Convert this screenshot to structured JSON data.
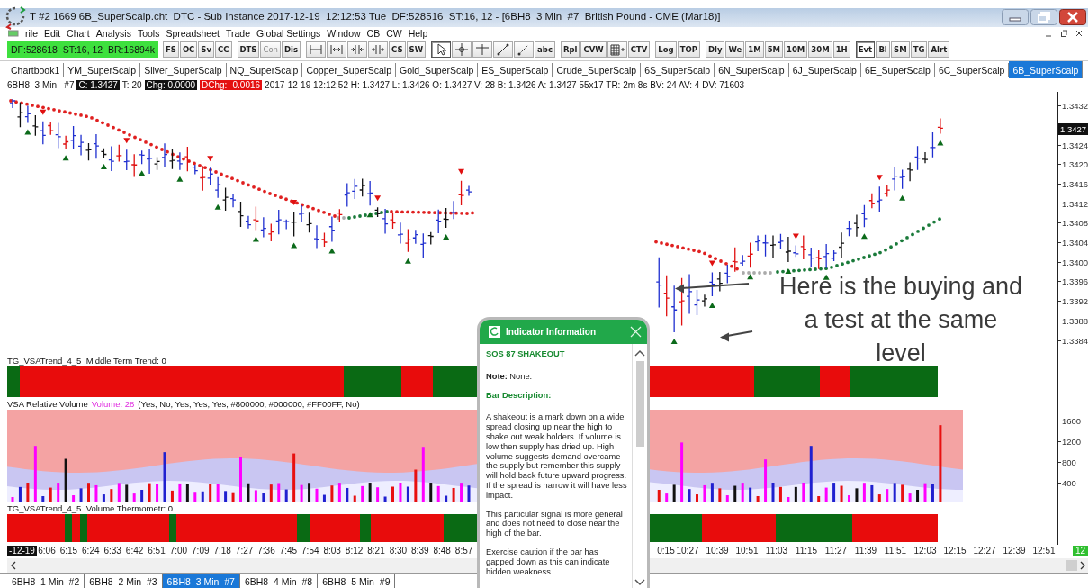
{
  "window": {
    "title": "T #2 1669 6B_SuperScalp.cht  DTC - Sub Instance 2017-12-19  12:12:53 Tue  DF:528516  ST:16, 12 - [6BH8  3 Min  #7  British Pound - CME (Mar18)]"
  },
  "menu": [
    "rile",
    "Edit",
    "Chart",
    "Analysis",
    "Tools",
    "Spreadsheet",
    "Trade",
    "Global Settings",
    "Window",
    "CB",
    "CW",
    "Help"
  ],
  "status_box": "DF:528618  ST:16, 12  BR:16894k",
  "toolbar": [
    {
      "kind": "text",
      "label": "FS",
      "disabled": false,
      "on": false
    },
    {
      "kind": "text",
      "label": "OC",
      "disabled": false,
      "on": false
    },
    {
      "kind": "text",
      "label": "Sv",
      "disabled": false,
      "on": false
    },
    {
      "kind": "text",
      "label": "CC",
      "disabled": false,
      "on": false
    },
    {
      "kind": "separator"
    },
    {
      "kind": "text",
      "label": "DTS",
      "disabled": false,
      "on": false
    },
    {
      "kind": "text",
      "label": "Con",
      "disabled": true,
      "on": false
    },
    {
      "kind": "text",
      "label": "Dis",
      "disabled": false,
      "on": false
    },
    {
      "kind": "separator"
    },
    {
      "kind": "icon",
      "disabled": false,
      "on": false
    },
    {
      "kind": "icon",
      "disabled": false,
      "on": false
    },
    {
      "kind": "icon",
      "disabled": false,
      "on": false
    },
    {
      "kind": "icon",
      "disabled": false,
      "on": false
    },
    {
      "kind": "text",
      "label": "CS",
      "disabled": false,
      "on": false
    },
    {
      "kind": "text",
      "label": "SW",
      "disabled": false,
      "on": false
    },
    {
      "kind": "separator"
    },
    {
      "kind": "icon",
      "disabled": false,
      "on": true
    },
    {
      "kind": "icon",
      "disabled": false,
      "on": false
    },
    {
      "kind": "icon",
      "disabled": false,
      "on": false
    },
    {
      "kind": "icon",
      "disabled": false,
      "on": false
    },
    {
      "kind": "icon",
      "disabled": false,
      "on": false
    },
    {
      "kind": "text",
      "label": "abc",
      "disabled": false,
      "on": false
    },
    {
      "kind": "separator"
    },
    {
      "kind": "text",
      "label": "Rpl",
      "disabled": false,
      "on": false
    },
    {
      "kind": "text",
      "label": "CVW",
      "disabled": false,
      "on": false
    },
    {
      "kind": "icon",
      "disabled": false,
      "on": false
    },
    {
      "kind": "text",
      "label": "CTV",
      "disabled": false,
      "on": false
    },
    {
      "kind": "separator"
    },
    {
      "kind": "text",
      "label": "Log",
      "disabled": false,
      "on": false
    },
    {
      "kind": "text",
      "label": "TOP",
      "disabled": false,
      "on": false
    },
    {
      "kind": "separator"
    },
    {
      "kind": "text",
      "label": "Dly",
      "disabled": false,
      "on": false
    },
    {
      "kind": "text",
      "label": "We",
      "disabled": false,
      "on": false
    },
    {
      "kind": "text",
      "label": "1M",
      "disabled": false,
      "on": false
    },
    {
      "kind": "text",
      "label": "5M",
      "disabled": false,
      "on": false
    },
    {
      "kind": "text",
      "label": "10M",
      "disabled": false,
      "on": false
    },
    {
      "kind": "text",
      "label": "30M",
      "disabled": false,
      "on": false
    },
    {
      "kind": "text",
      "label": "1H",
      "disabled": false,
      "on": false
    },
    {
      "kind": "separator"
    },
    {
      "kind": "text",
      "label": "Evt",
      "disabled": false,
      "on": true
    },
    {
      "kind": "text",
      "label": "Bl",
      "disabled": false,
      "on": false
    },
    {
      "kind": "text",
      "label": "SM",
      "disabled": false,
      "on": false
    },
    {
      "kind": "text",
      "label": "TG",
      "disabled": false,
      "on": false
    },
    {
      "kind": "text",
      "label": "Alrt",
      "disabled": false,
      "on": false
    }
  ],
  "chartbook_tabs": [
    {
      "label": "Chartbook1",
      "selected": false
    },
    {
      "label": "YM_SuperScalp",
      "selected": false
    },
    {
      "label": "Silver_SuperScalp",
      "selected": false
    },
    {
      "label": "NQ_SuperScalp",
      "selected": false
    },
    {
      "label": "Copper_SuperScalp",
      "selected": false
    },
    {
      "label": "Gold_SuperScalp",
      "selected": false
    },
    {
      "label": "ES_SuperScalp",
      "selected": false
    },
    {
      "label": "Crude_SuperScalp",
      "selected": false
    },
    {
      "label": "6S_SuperScalp",
      "selected": false
    },
    {
      "label": "6N_SuperScalp",
      "selected": false
    },
    {
      "label": "6J_SuperScalp",
      "selected": false
    },
    {
      "label": "6E_SuperScalp",
      "selected": false
    },
    {
      "label": "6C_SuperScalp",
      "selected": false
    },
    {
      "label": "6B_SuperScalp",
      "selected": true
    }
  ],
  "info_line": [
    {
      "kind": "plain",
      "text": "6BH8  3 Min   #7"
    },
    {
      "kind": "dark",
      "text": "C: 1.3427"
    },
    {
      "kind": "plain",
      "text": "T: 20"
    },
    {
      "kind": "dark",
      "text": "Chg: 0.0000"
    },
    {
      "kind": "alert",
      "text": "DChg: -0.0016"
    },
    {
      "kind": "plain",
      "text": "2017-12-19 12:12:52 H: 1.3427 L: 1.3426 O: 1.3427 V: 28 B: 1.3426 A: 1.3427 55x17 TR: 2m 8s BV: 24 AV: 4 DV: 71603"
    }
  ],
  "price_panel": {
    "ticks": [
      "1.3432",
      "1.3424",
      "1.3420",
      "1.3416",
      "1.3412",
      "1.3408",
      "1.3404",
      "1.3400",
      "1.3396",
      "1.3392",
      "1.3388",
      "1.3384"
    ],
    "current_price": "1.3427"
  },
  "trend_panel": {
    "title": "TG_VSATrend_4_5  Middle Term Trend: 0"
  },
  "volume_panel": {
    "title": "VSA Relative Volume",
    "reading": "Volume: 28",
    "settings": "(Yes, No, Yes, Yes, Yes, #800000, #000000, #FF00FF, No)",
    "ticks": [
      "1600",
      "1200",
      "800",
      "400"
    ]
  },
  "thermometer_panel": {
    "title": "TG_VSATrend_4_5  Volume Thermometr: 0"
  },
  "time_axis": {
    "start_label": "-12-19",
    "labels_left": [
      "6:06",
      "6:15",
      "6:24",
      "6:33",
      "6:42",
      "6:51",
      "7:00",
      "7:09",
      "7:18",
      "7:27",
      "7:36",
      "7:45",
      "7:54",
      "8:03",
      "8:12",
      "8:21",
      "8:30",
      "8:39",
      "8:48",
      "8:57"
    ],
    "labels_right": [
      "0:15",
      "10:27",
      "10:39",
      "10:51",
      "11:03",
      "11:15",
      "11:27",
      "11:39",
      "11:51",
      "12:03",
      "12:15",
      "12:27",
      "12:39",
      "12:51"
    ],
    "current_time": "12"
  },
  "bottom_tabs": [
    {
      "label": "6BH8  1 Min  #2",
      "selected": false
    },
    {
      "label": "6BH8  2 Min  #3",
      "selected": false
    },
    {
      "label": "6BH8  3 Min  #7",
      "selected": true
    },
    {
      "label": "6BH8  4 Min  #8",
      "selected": false
    },
    {
      "label": "6BH8  5 Min  #9",
      "selected": false
    }
  ],
  "popup": {
    "title": "Indicator Information",
    "signal": "SOS 87 SHAKEOUT",
    "note": "**Note:** None.",
    "section": "Bar Description:",
    "paragraphs": [
      "A shakeout is a mark down on a wide spread closing up near the high to shake out weak holders. If volume is low then supply has dried up. High volume suggests demand overcame the supply but remember this supply will hold back future upward progress. If the spread is narrow it will have less impact.",
      "This particular signal is more general and does not need to close near the high of the bar.",
      "Exercise caution if the bar has gapped down as this can indicate hidden weakness."
    ]
  },
  "annotation": [
    "Here is the buying and",
    "a test at the same",
    "level"
  ]
}
